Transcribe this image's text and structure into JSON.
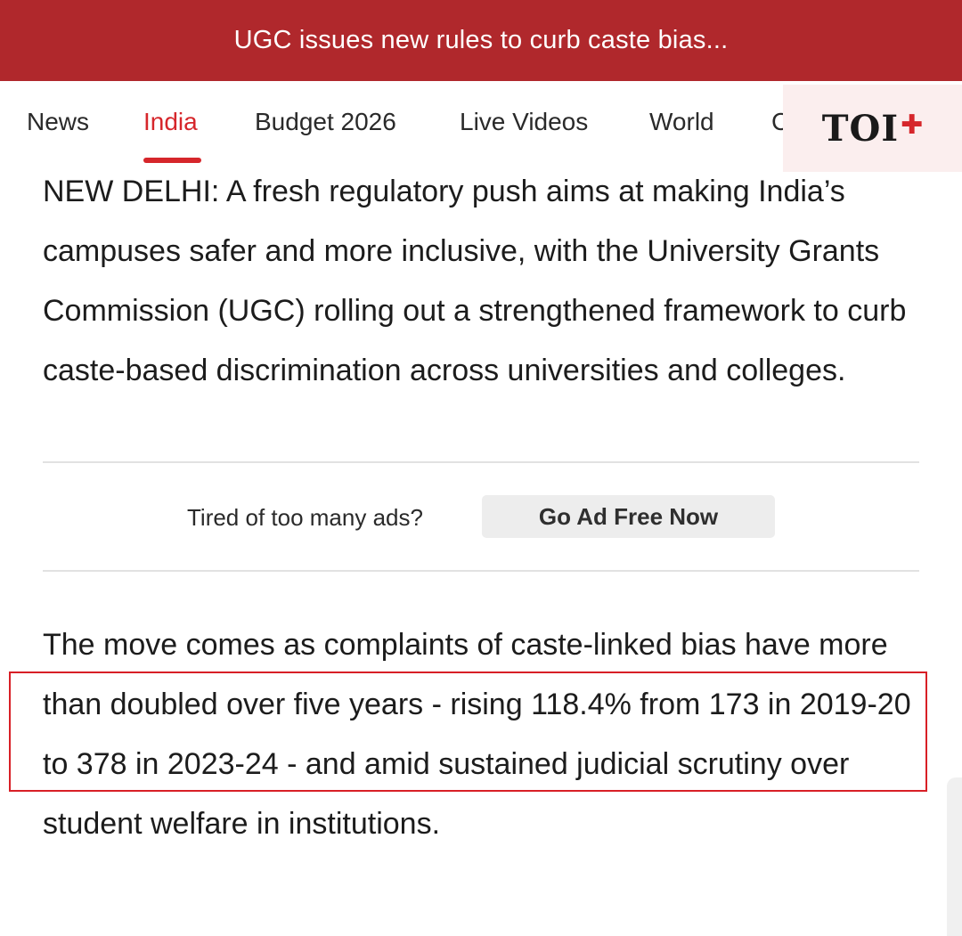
{
  "banner": {
    "headline": "UGC issues new rules to curb caste bias..."
  },
  "nav": {
    "items": [
      {
        "label": "News"
      },
      {
        "label": "India"
      },
      {
        "label": "Budget 2026"
      },
      {
        "label": "Live Videos"
      },
      {
        "label": "World"
      },
      {
        "label": "C"
      }
    ],
    "active": "India"
  },
  "brand": {
    "name": "TOI",
    "plus": "✚"
  },
  "article": {
    "para1": "NEW DELHI: A fresh regulatory push aims at making India’s campuses safer and more inclusive, with the University Grants Commission (UGC) rolling out a strengthened framework to curb caste-based discrimination across universities and colleges.",
    "para2": "The move comes as complaints of caste-linked bias have more than doubled over five years - rising 118.4% from 173 in 2019-20 to 378 in 2023-24 - and amid sustained judicial scrutiny over student welfare in institutions."
  },
  "ad_prompt": {
    "text": "Tired of too many ads?",
    "button": "Go Ad Free Now"
  },
  "colors": {
    "banner_bg": "#b0282c",
    "accent": "#d6262b",
    "highlight": "#d81f26"
  }
}
